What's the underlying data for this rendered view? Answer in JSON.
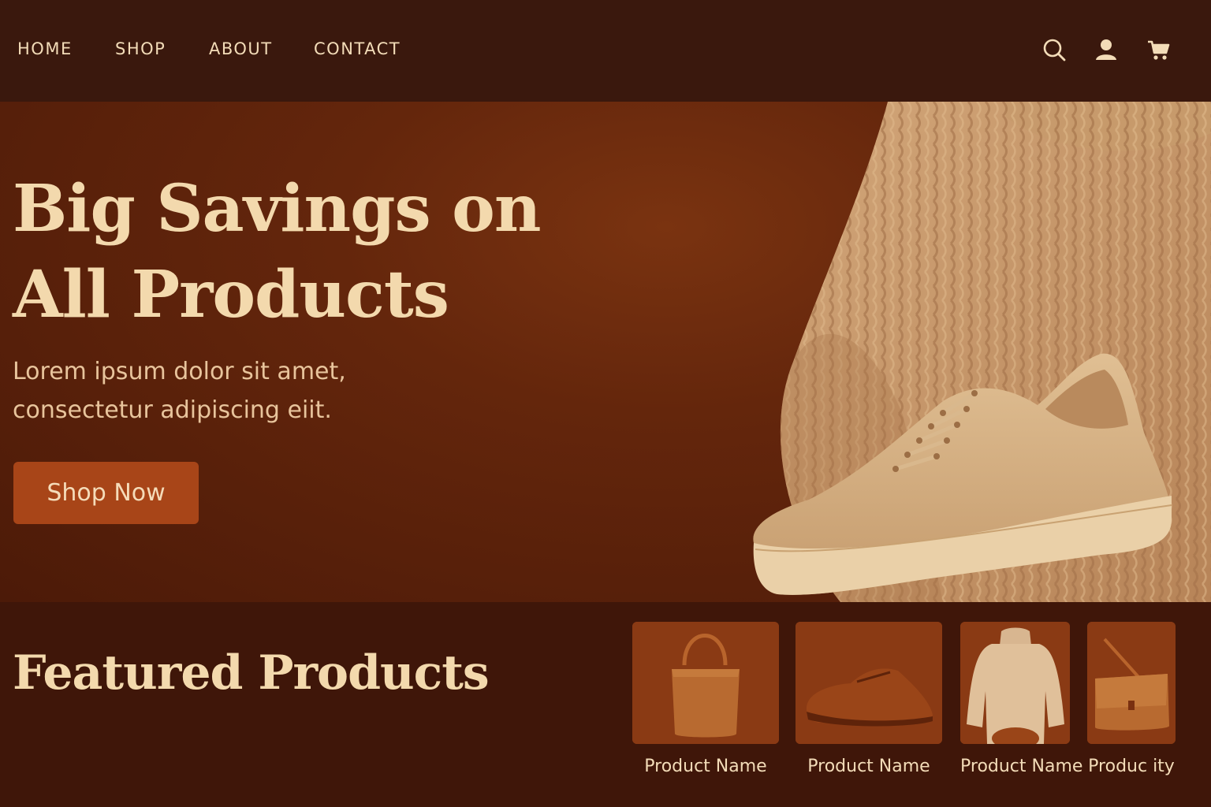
{
  "nav": {
    "links": [
      "HOME",
      "SHOP",
      "ABOUT",
      "CONTACT"
    ],
    "icons": [
      "search-icon",
      "user-icon",
      "cart-icon"
    ]
  },
  "hero": {
    "title_line1": "Big Savings on",
    "title_line2": "All Products",
    "subtitle_line1": "Lorem ipsum dolor sit amet,",
    "subtitle_line2": "consectetur adipiscing eiit.",
    "cta": "Shop Now"
  },
  "featured": {
    "title": "Featured Products",
    "products": [
      {
        "name": "Product Name",
        "image": "handbag"
      },
      {
        "name": "Product Name",
        "image": "leather-shoe"
      },
      {
        "name": "Product Name",
        "image": "sweater"
      },
      {
        "name": "Produc ity",
        "image": "shoulder-bag"
      }
    ]
  },
  "colors": {
    "nav_bg": "#3a180d",
    "hero_bg": "#64260c",
    "accent": "#a84518",
    "text_light": "#f3d9ad"
  }
}
